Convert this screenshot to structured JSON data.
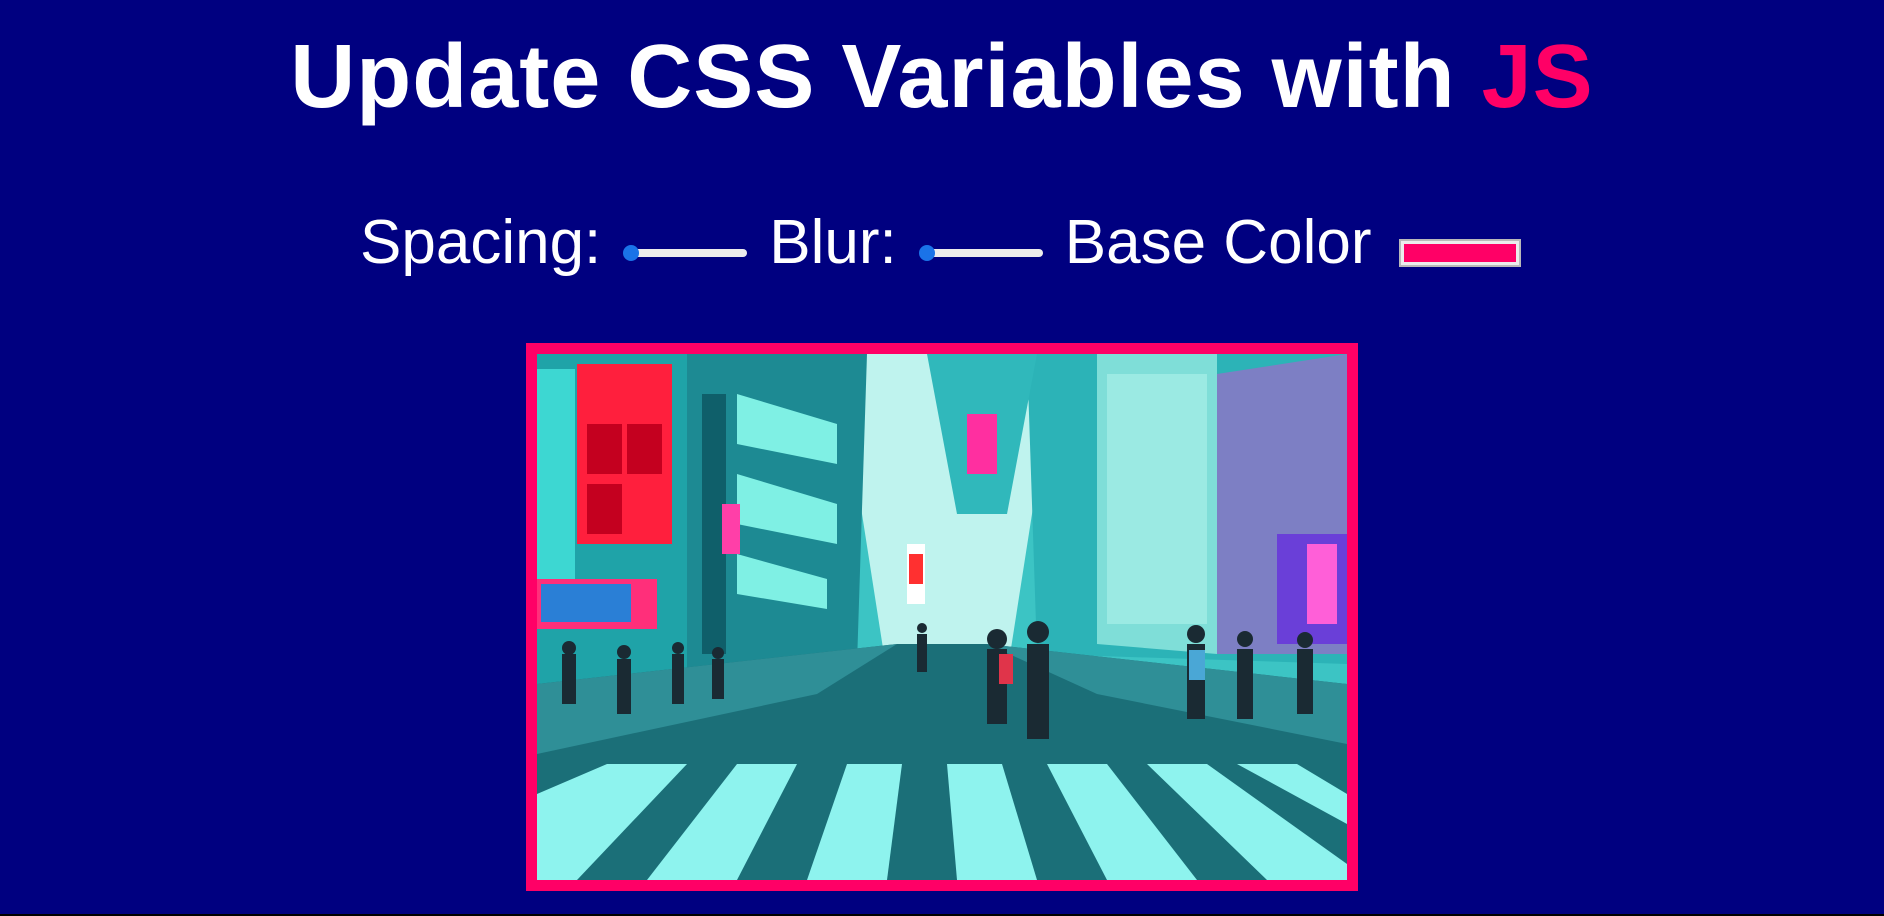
{
  "title": {
    "text": "Update CSS Variables with ",
    "highlight": "JS"
  },
  "controls": {
    "spacing_label": "Spacing:",
    "spacing_value": 0,
    "blur_label": "Blur:",
    "blur_value": 0,
    "base_color_label": "Base Color",
    "base_color_value": "#ff0066"
  },
  "colors": {
    "background": "#000080",
    "accent": "#ff0066",
    "text": "#ffffff",
    "slider_thumb": "#1a73e8",
    "slider_track": "#ececec"
  },
  "image": {
    "subject": "neon-lit city street with pedestrian crosswalk"
  }
}
